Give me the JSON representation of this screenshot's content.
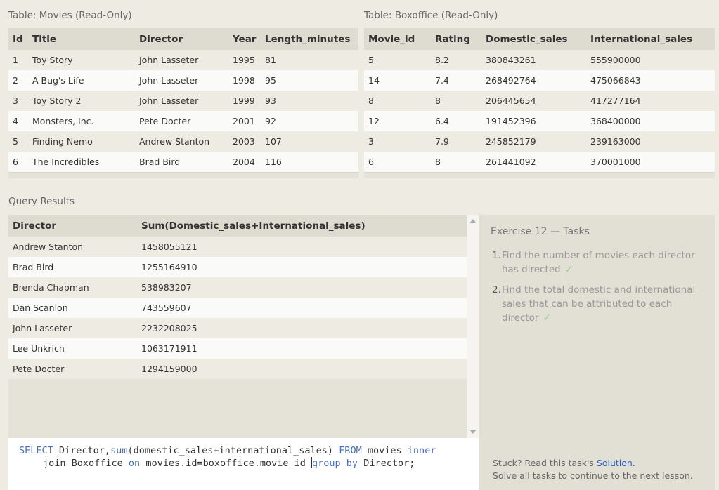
{
  "movies": {
    "caption": "Table: Movies (Read-Only)",
    "columns": [
      "Id",
      "Title",
      "Director",
      "Year",
      "Length_minutes"
    ],
    "rows": [
      [
        "1",
        "Toy Story",
        "John Lasseter",
        "1995",
        "81"
      ],
      [
        "2",
        "A Bug's Life",
        "John Lasseter",
        "1998",
        "95"
      ],
      [
        "3",
        "Toy Story 2",
        "John Lasseter",
        "1999",
        "93"
      ],
      [
        "4",
        "Monsters, Inc.",
        "Pete Docter",
        "2001",
        "92"
      ],
      [
        "5",
        "Finding Nemo",
        "Andrew Stanton",
        "2003",
        "107"
      ],
      [
        "6",
        "The Incredibles",
        "Brad Bird",
        "2004",
        "116"
      ]
    ]
  },
  "boxoffice": {
    "caption": "Table: Boxoffice (Read-Only)",
    "columns": [
      "Movie_id",
      "Rating",
      "Domestic_sales",
      "International_sales"
    ],
    "rows": [
      [
        "5",
        "8.2",
        "380843261",
        "555900000"
      ],
      [
        "14",
        "7.4",
        "268492764",
        "475066843"
      ],
      [
        "8",
        "8",
        "206445654",
        "417277164"
      ],
      [
        "12",
        "6.4",
        "191452396",
        "368400000"
      ],
      [
        "3",
        "7.9",
        "245852179",
        "239163000"
      ],
      [
        "6",
        "8",
        "261441092",
        "370001000"
      ]
    ]
  },
  "results": {
    "caption": "Query Results",
    "columns": [
      "Director",
      "Sum(Domestic_sales+International_sales)"
    ],
    "rows": [
      [
        "Andrew Stanton",
        "1458055121"
      ],
      [
        "Brad Bird",
        "1255164910"
      ],
      [
        "Brenda Chapman",
        "538983207"
      ],
      [
        "Dan Scanlon",
        "743559607"
      ],
      [
        "John Lasseter",
        "2232208025"
      ],
      [
        "Lee Unkrich",
        "1063171911"
      ],
      [
        "Pete Docter",
        "1294159000"
      ]
    ]
  },
  "editor": {
    "line1": {
      "kw1": "SELECT",
      "t1": " Director,",
      "kw2": "sum",
      "t2": "(domestic_sales+international_sales) ",
      "kw3": "FROM",
      "t3": " movies ",
      "kw4": "inner"
    },
    "line2": {
      "t1": "join Boxoffice ",
      "kw1": "on",
      "t2": " movies.id=boxoffice.movie_id ",
      "kw2": "group by",
      "t3": " Director;"
    }
  },
  "tasks": {
    "title": "Exercise 12 — Tasks",
    "items": [
      {
        "num": "1.",
        "text": "Find the number of movies each director has directed",
        "check": "✓"
      },
      {
        "num": "2.",
        "text": "Find the total domestic and international sales that can be attributed to each director",
        "check": "✓"
      }
    ],
    "stuck_text": "Stuck? Read this task's ",
    "solution_link": "Solution.",
    "continue_text": "Solve all tasks to continue to the next lesson."
  },
  "colors": {
    "background": "#eeebe2",
    "header": "#dedbd0",
    "keyword": "#4a6fb5",
    "link": "#2e64b5",
    "check": "#9cc98a"
  }
}
